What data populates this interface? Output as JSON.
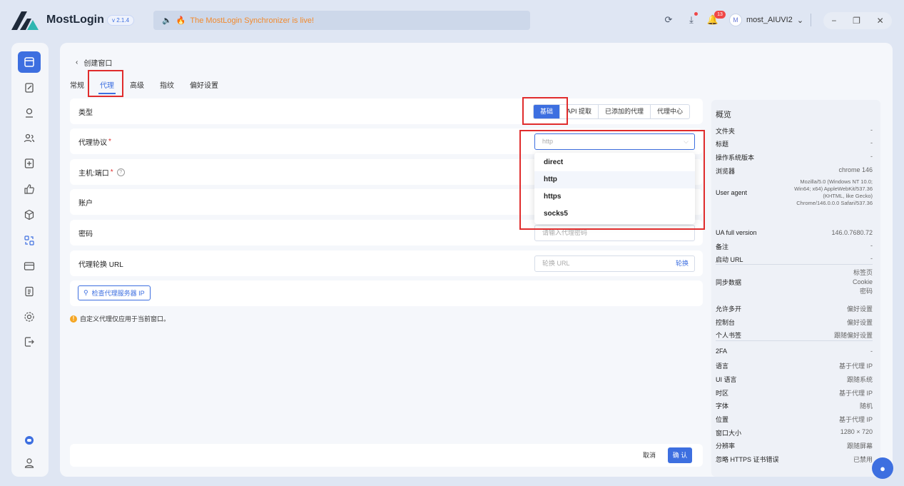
{
  "app": {
    "name": "MostLogin",
    "version": "v 2.1.4"
  },
  "announcement": "The MostLogin Synchronizer is live!",
  "notifications_count": "13",
  "user": {
    "initial": "M",
    "name": "most_AIUVI2"
  },
  "breadcrumb": {
    "title": "创建窗口"
  },
  "tabs": [
    "常规",
    "代理",
    "高级",
    "指纹",
    "偏好设置"
  ],
  "form": {
    "type_label": "类型",
    "type_options": [
      "基础",
      "API 提取",
      "已添加的代理",
      "代理中心"
    ],
    "protocol_label": "代理协议",
    "protocol_value": "http",
    "protocol_options": [
      "direct",
      "http",
      "https",
      "socks5"
    ],
    "host_label": "主机:端口",
    "account_label": "账户",
    "password_label": "密码",
    "password_placeholder": "请输入代理密码",
    "rotate_label": "代理轮换 URL",
    "rotate_placeholder": "轮换 URL",
    "rotate_button": "轮换",
    "check_button": "检查代理服务器 IP",
    "note": "自定义代理仅应用于当前窗口。",
    "cancel": "取消",
    "confirm": "确 认"
  },
  "overview": {
    "title": "概览",
    "rows": [
      {
        "k": "文件夹",
        "v": "-"
      },
      {
        "k": "标题",
        "v": "-"
      },
      {
        "k": "操作系统版本",
        "v": "-"
      },
      {
        "k": "浏览器",
        "v": "chrome  146"
      },
      {
        "k": "User agent",
        "v": "Mozilla/5.0 (Windows NT 10.0; Win64; x64) AppleWebKit/537.36 (KHTML, like Gecko) Chrome/146.0.0.0 Safari/537.36"
      },
      {
        "k": "UA full version",
        "v": "146.0.7680.72"
      },
      {
        "k": "备注",
        "v": "-"
      },
      {
        "k": "启动 URL",
        "v": "-"
      },
      {
        "k": "同步数据",
        "v": "标签页\nCookie\n密码"
      },
      {
        "k": "允许多开",
        "v": "偏好设置"
      },
      {
        "k": "控制台",
        "v": "偏好设置"
      },
      {
        "k": "个人书签",
        "v": "跟随偏好设置"
      },
      {
        "k": "2FA",
        "v": "-"
      },
      {
        "k": "语言",
        "v": "基于代理 IP"
      },
      {
        "k": "UI 语言",
        "v": "跟随系统"
      },
      {
        "k": "时区",
        "v": "基于代理 IP"
      },
      {
        "k": "字体",
        "v": "随机"
      },
      {
        "k": "位置",
        "v": "基于代理 IP"
      },
      {
        "k": "窗口大小",
        "v": "1280 × 720"
      },
      {
        "k": "分辨率",
        "v": "跟随屏幕"
      },
      {
        "k": "忽略 HTTPS 证书错误",
        "v": "已禁用"
      }
    ]
  },
  "colors": {
    "accent": "#3d6fe0",
    "highlight": "#e02c2c"
  }
}
